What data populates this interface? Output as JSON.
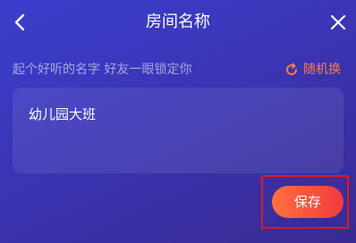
{
  "header": {
    "title": "房间名称",
    "back_icon": "chevron-left-icon",
    "close_icon": "close-icon"
  },
  "form": {
    "hint": "起个好听的名字 好友一眼锁定你",
    "shuffle_label": "随机换",
    "shuffle_icon": "refresh-icon",
    "name_value": "幼儿园大班"
  },
  "actions": {
    "save_label": "保存"
  },
  "colors": {
    "accent": "#ff7a45",
    "save_gradient_start": "#ff7040",
    "save_gradient_end": "#f23a3e",
    "highlight_border": "#e0191b"
  }
}
